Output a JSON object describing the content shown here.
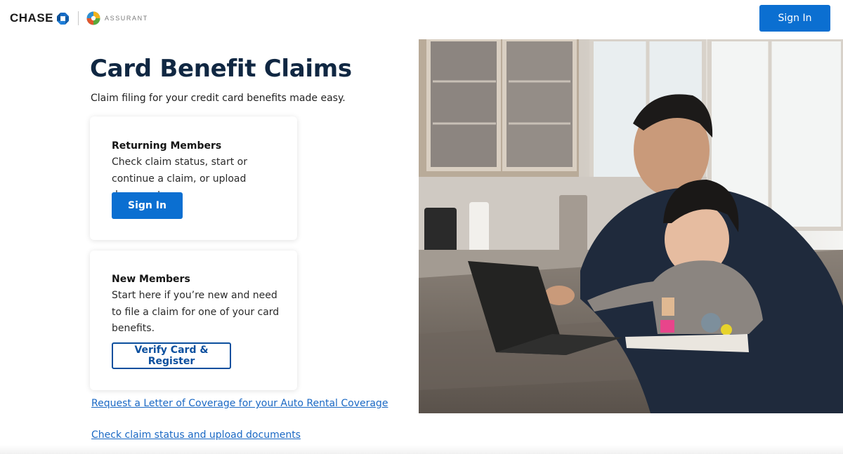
{
  "header": {
    "chase_logo_text": "CHASE",
    "assurant_logo_text": "ASSURANT",
    "sign_in_label": "Sign In"
  },
  "main": {
    "title": "Card Benefit Claims",
    "subtitle": "Claim filing for your credit card benefits made easy.",
    "returning": {
      "title": "Returning Members",
      "body": "Check claim status, start or continue a claim, or upload documents.",
      "button_label": "Sign In"
    },
    "new_members": {
      "title": "New Members",
      "body": "Start here if you’re new and need to file a claim for one of your card benefits.",
      "button_label": "Verify Card & Register"
    },
    "links": {
      "letter_of_coverage": "Request a Letter of Coverage for your Auto Rental Coverage",
      "check_status": "Check claim status and upload documents"
    }
  },
  "colors": {
    "primary_blue": "#0b6fd1",
    "title_navy": "#102742",
    "link_blue": "#1a68c4"
  },
  "icons": [
    "chase-octagon-logo-icon",
    "assurant-globe-logo-icon"
  ],
  "hero_image": "father-and-daughter-using-tablet-in-kitchen-photo"
}
